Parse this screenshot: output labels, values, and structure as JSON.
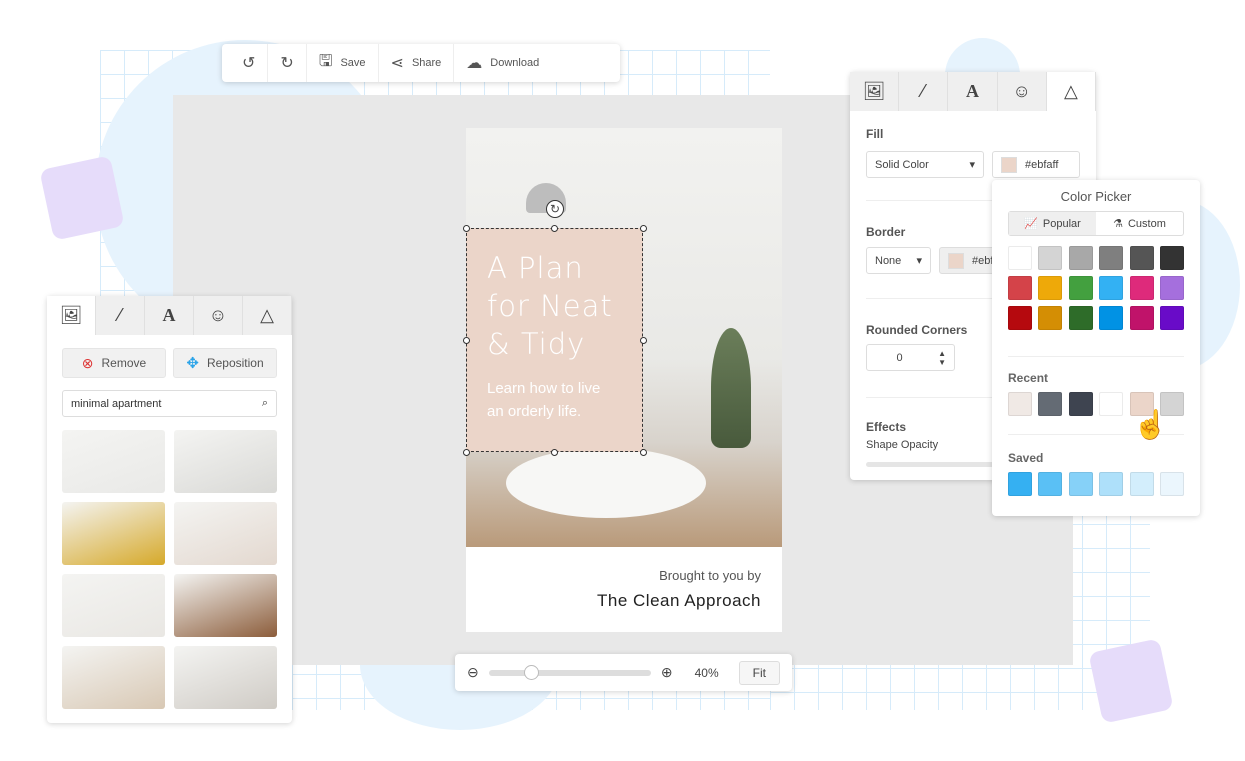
{
  "toolbar": {
    "undo_icon": "undo-icon",
    "redo_icon": "redo-icon",
    "save": "Save",
    "share": "Share",
    "download": "Download"
  },
  "design": {
    "title_lines": [
      "A Plan",
      "for Neat",
      "& Tidy"
    ],
    "subtitle_lines": [
      "Learn how to live",
      "an orderly life."
    ],
    "brought_by": "Brought to you by",
    "brand": "The Clean Approach",
    "box_color": "#ebd5c9"
  },
  "left_panel": {
    "tabs": [
      "image",
      "magic-wand",
      "text",
      "emoji",
      "shape"
    ],
    "remove": "Remove",
    "reposition": "Reposition",
    "search_value": "minimal apartment",
    "thumbs": [
      "#e9e9e7",
      "#d9d9d6",
      "#d6a92a",
      "#e3d8cf",
      "#e9e7e3",
      "#8c5d3b",
      "#d8c8b4",
      "#cfcbc5"
    ]
  },
  "right_panel": {
    "fill_label": "Fill",
    "fill_type": "Solid Color",
    "fill_color": "#ebfaff",
    "border_label": "Border",
    "border_type": "None",
    "border_color": "#ebfaff",
    "rounded_label": "Rounded Corners",
    "rounded_value": "0",
    "effects_label": "Effects",
    "opacity_label": "Shape Opacity"
  },
  "picker": {
    "title": "Color Picker",
    "tab_popular": "Popular",
    "tab_custom": "Custom",
    "recent_label": "Recent",
    "saved_label": "Saved",
    "popular": [
      "#ffffff",
      "#d4d4d4",
      "#a8a8a8",
      "#7f7f7f",
      "#555555",
      "#333333",
      "#d44349",
      "#eea909",
      "#43a03f",
      "#33b1f3",
      "#de2a7b",
      "#a56fdd",
      "#b5090e",
      "#d48e04",
      "#2e6c29",
      "#0192e4",
      "#c0136a",
      "#690bc8"
    ],
    "recent": [
      "#f0e9e5",
      "#646b74",
      "#3e4450",
      "#ffffff",
      "#ebd5c9",
      "#d4d4d4"
    ],
    "saved": [
      "#35b0f2",
      "#5ac0f5",
      "#86d1f8",
      "#aee0fa",
      "#d3eefc",
      "#ebf6fd"
    ]
  },
  "zoom": {
    "value": "40%",
    "fit": "Fit",
    "level": 0.25
  }
}
